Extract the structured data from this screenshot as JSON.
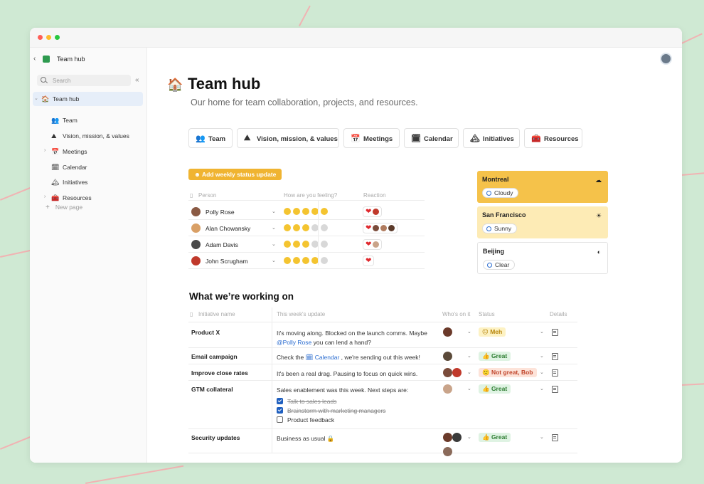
{
  "window": {
    "title": "Team hub"
  },
  "sidebar": {
    "title": "Team hub",
    "search_placeholder": "Search",
    "items": [
      {
        "label": "Team hub",
        "icon": "🏠",
        "active": true,
        "caret": "⌄",
        "indent": 0
      },
      {
        "label": "Team",
        "icon": "👥",
        "indent": 1
      },
      {
        "label": "Vision, mission, & values",
        "icon": "⛰",
        "indent": 1
      },
      {
        "label": "Meetings",
        "icon": "📅",
        "caret": "›",
        "indent": 1
      },
      {
        "label": "Calendar",
        "icon": "🗓",
        "indent": 1
      },
      {
        "label": "Initiatives",
        "icon": "🏔",
        "indent": 1
      },
      {
        "label": "Resources",
        "icon": "🧰",
        "caret": "›",
        "indent": 1
      }
    ],
    "new_page": "New page"
  },
  "page": {
    "title": "Team hub",
    "subtitle": "Our home for team collaboration, projects, and resources."
  },
  "tabs": [
    {
      "label": "Team",
      "icon": "👥"
    },
    {
      "label": "Vision, mission, & values",
      "icon": "⛰"
    },
    {
      "label": "Meetings",
      "icon": "📅"
    },
    {
      "label": "Calendar",
      "icon": "🗓"
    },
    {
      "label": "Initiatives",
      "icon": "🏔"
    },
    {
      "label": "Resources",
      "icon": "🧰"
    }
  ],
  "status_button": "Add weekly status update",
  "feelings": {
    "headers": {
      "person": "Person",
      "feeling": "How are you feeling?",
      "reaction": "Reaction"
    },
    "rows": [
      {
        "name": "Polly Rose",
        "score": 5,
        "avatar_color": "#8a5a44",
        "reactors": [
          "#c0392b"
        ]
      },
      {
        "name": "Alan Chowansky",
        "score": 3,
        "avatar_color": "#d9a066",
        "reactors": [
          "#7a4b3a",
          "#b07b5e",
          "#5b3a2a"
        ]
      },
      {
        "name": "Adam Davis",
        "score": 3,
        "avatar_color": "#4a4a4a",
        "reactors": [
          "#c9a48a"
        ]
      },
      {
        "name": "John Scrugham",
        "score": 4,
        "avatar_color": "#c0392b",
        "reactors": []
      }
    ]
  },
  "weather": [
    {
      "city": "Montreal",
      "condition": "Cloudy",
      "bg": "#f5c24a",
      "icon": "☁"
    },
    {
      "city": "San Francisco",
      "condition": "Sunny",
      "bg": "#fdebb5",
      "icon": "☀"
    },
    {
      "city": "Beijing",
      "condition": "Clear",
      "bg": "#ffffff",
      "icon": "◐"
    }
  ],
  "initiatives": {
    "title": "What we’re working on",
    "headers": {
      "name": "Initiative name",
      "update": "This week's update",
      "who": "Who's on it",
      "status": "Status",
      "details": "Details"
    },
    "rows": [
      {
        "name": "Product X",
        "update_a": "It's moving along. Blocked on the launch comms. Maybe ",
        "mention": "@Polly Rose",
        "update_b": " you can lend a hand?",
        "status": "😐 Meh",
        "status_bg": "#fdf2c4",
        "status_color": "#b8860b",
        "who": [
          "#6b3a2a"
        ]
      },
      {
        "name": "Email campaign",
        "update_a": "Check the ",
        "mention": "🗓 Calendar",
        "update_b": " , we're sending out this week!",
        "status": "👍 Great",
        "status_bg": "#dff3e3",
        "status_color": "#2e7d32",
        "who": [
          "#5b4a3a"
        ]
      },
      {
        "name": "Improve close rates",
        "update_a": "It's been a real drag. Pausing to focus on quick wins.",
        "mention": "",
        "update_b": "",
        "status": "🙁 Not great, Bob",
        "status_bg": "#fde3d9",
        "status_color": "#c0452b",
        "who": [
          "#7a4b3a",
          "#c0392b"
        ]
      },
      {
        "name": "GTM collateral",
        "update_a": "Sales enablement was this week. Next steps are:",
        "mention": "",
        "update_b": "",
        "status": "👍 Great",
        "status_bg": "#dff3e3",
        "status_color": "#2e7d32",
        "who": [
          "#c9a48a"
        ],
        "tasks": [
          {
            "label": "Talk to sales leads",
            "done": true
          },
          {
            "label": "Brainstorm with marketing managers",
            "done": true
          },
          {
            "label": "Product feedback",
            "done": false
          }
        ]
      },
      {
        "name": "Security updates",
        "update_a": "Business as usual 🔒",
        "mention": "",
        "update_b": "",
        "status": "👍 Great",
        "status_bg": "#dff3e3",
        "status_color": "#2e7d32",
        "who": [
          "#6b3a2a",
          "#3a3a3a",
          "#8a6a5a"
        ]
      }
    ]
  }
}
